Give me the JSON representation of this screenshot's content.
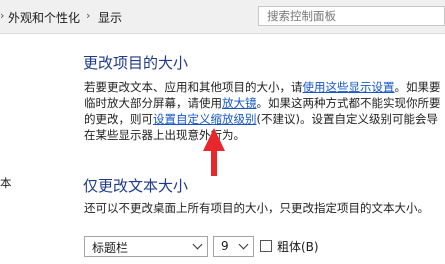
{
  "breadcrumb": {
    "items": [
      "外观和个性化",
      "显示"
    ]
  },
  "search": {
    "placeholder": "搜索控制面板"
  },
  "section_size": {
    "title": "更改项目的大小",
    "line1_a": "若要更改文本、应用和其他项目的大小，请",
    "line1_link": "使用这些显示设置",
    "line1_b": "。如果要",
    "line2_a": "临时放大部分屏幕，请使用",
    "line2_link": "放大镜",
    "line2_b": "。如果这两种方式都不能实现你所要",
    "line3_a": "的更改，则可",
    "line3_link": "设置自定义缩放级别",
    "line3_b": "(不建议)。设置自定义级别可能会导",
    "line4": "在某些显示器上出现意外行为。"
  },
  "side_char": "本",
  "section_text": {
    "title": "仅更改文本大小",
    "description": "还可以不更改桌面上所有项目的大小，只更改指定项目的文本大小。",
    "item_select": "标题栏",
    "size_select": "9",
    "bold_label": "粗体(B)"
  },
  "colors": {
    "heading": "#1e3a8a",
    "link": "#1556c9",
    "arrow": "#e8262b"
  }
}
